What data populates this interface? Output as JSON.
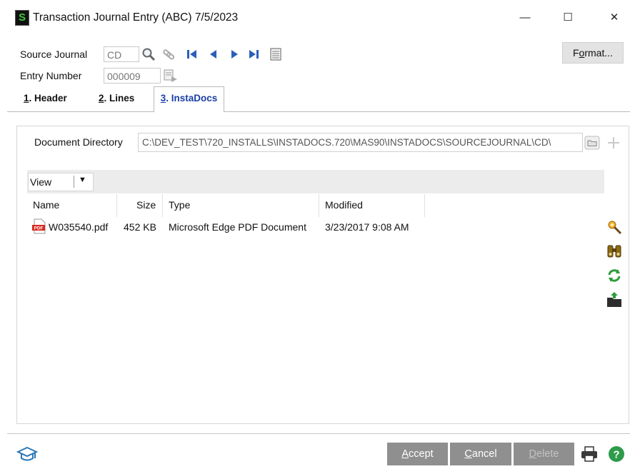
{
  "window": {
    "title": "Transaction Journal Entry (ABC) 7/5/2023",
    "app_icon_letter": "S",
    "minimize": "—",
    "maximize": "☐",
    "close": "✕"
  },
  "header": {
    "source_journal_label": "Source Journal",
    "source_journal_value": "CD",
    "entry_number_label": "Entry Number",
    "entry_number_value": "000009",
    "format_button": "Format..."
  },
  "tabs": [
    {
      "key": "1",
      "label": ". Header"
    },
    {
      "key": "2",
      "label": ". Lines"
    },
    {
      "key": "3",
      "label": ". InstaDocs",
      "active": true
    }
  ],
  "instadocs": {
    "directory_label": "Document Directory",
    "directory_value": "C:\\DEV_TEST\\720_INSTALLS\\INSTADOCS.720\\MAS90\\INSTADOCS\\SOURCEJOURNAL\\CD\\",
    "view_label": "View",
    "columns": [
      "Name",
      "Size",
      "Type",
      "Modified"
    ],
    "rows": [
      {
        "name": "W035540.pdf",
        "size": "452 KB",
        "type": "Microsoft Edge PDF Document",
        "modified": "3/23/2017 9:08 AM",
        "icon_text": "PDF"
      }
    ]
  },
  "footer": {
    "accept": {
      "key": "A",
      "rest": "ccept"
    },
    "cancel": {
      "key": "C",
      "rest": "ancel"
    },
    "delete": {
      "key": "D",
      "rest": "elete"
    }
  },
  "colors": {
    "tab_active_text": "#1a3fa6",
    "button_bg": "#8f8f8f",
    "help_green": "#2e9b4a"
  }
}
